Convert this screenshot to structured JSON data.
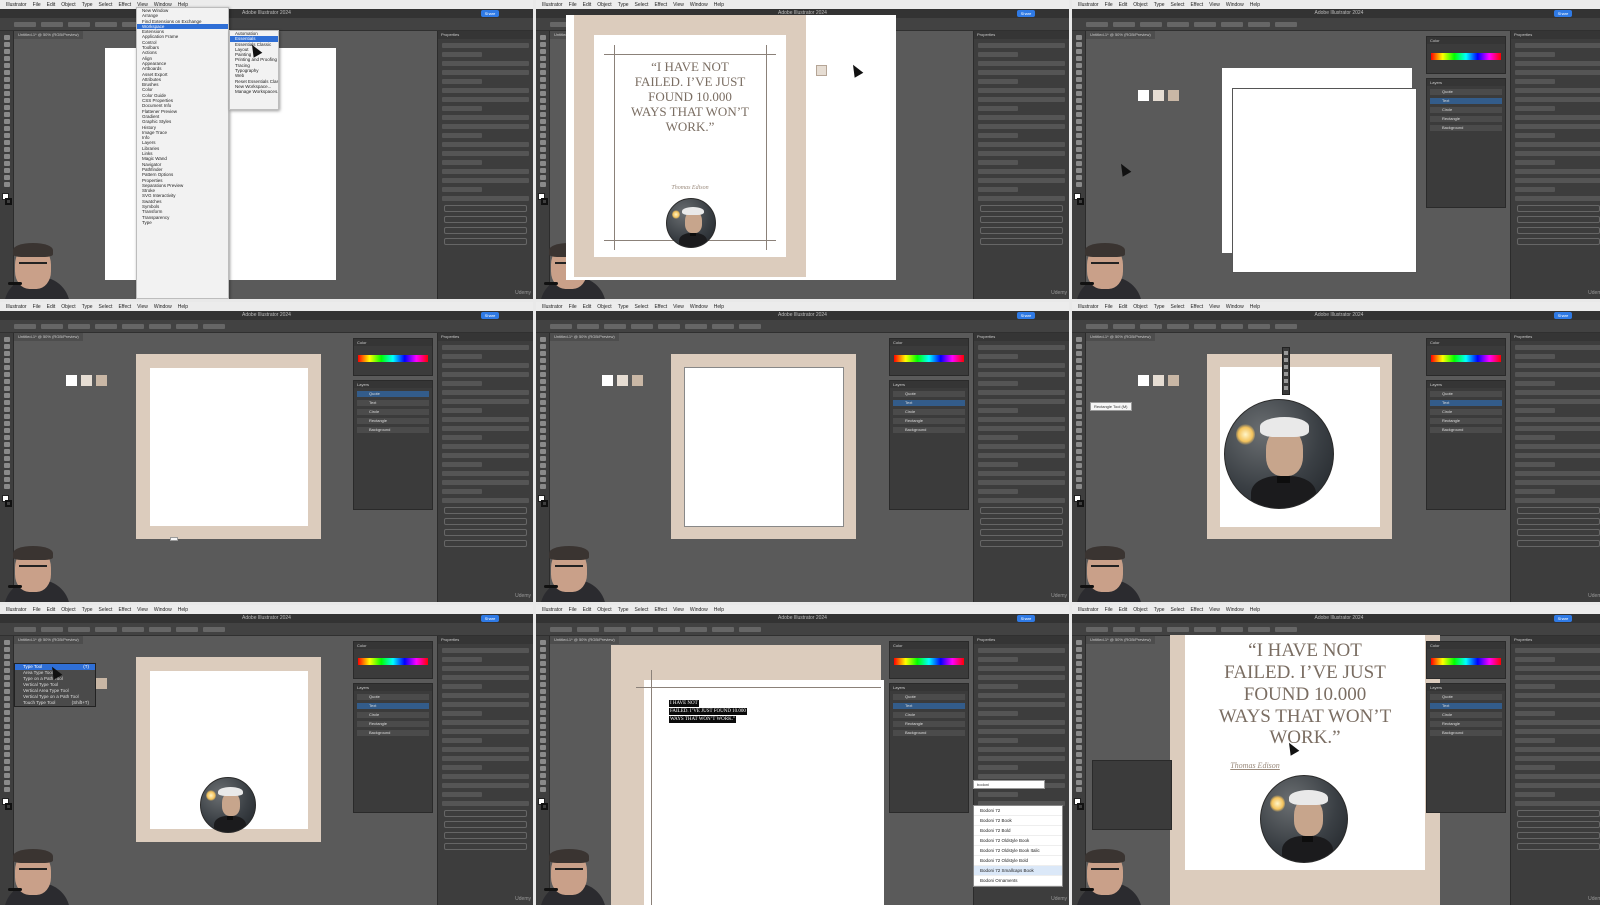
{
  "app": {
    "menubar": [
      "Illustrator",
      "File",
      "Edit",
      "Object",
      "Type",
      "Select",
      "Effect",
      "View",
      "Window",
      "Help"
    ],
    "title": "Adobe Illustrator 2024",
    "share": "Share",
    "doc_tab": "Untitled-1* @ 50% (RGB/Preview)",
    "watermark": "Udemy"
  },
  "colors": {
    "beige": "#dcccbd",
    "quote_text": "#7a6d62",
    "selection": "#2f6fd6",
    "canvas": "#5a5a5a"
  },
  "panels": {
    "properties": "Properties",
    "layers": "Layers",
    "color": "Color",
    "layer_items": [
      "Quote",
      "Text",
      "Circle",
      "Rectangle",
      "Background"
    ]
  },
  "window_menu": {
    "items": [
      "New Window",
      "Arrange",
      "Find Extensions on Exchange",
      "Workspace",
      "Extensions",
      "Application Frame",
      "Control",
      "Toolbars",
      "Actions",
      "Align",
      "Appearance",
      "Artboards",
      "Asset Export",
      "Attributes",
      "Brushes",
      "Color",
      "Color Guide",
      "CSS Properties",
      "Document Info",
      "Flattener Preview",
      "Gradient",
      "Graphic Styles",
      "History",
      "Image Trace",
      "Info",
      "Layers",
      "Libraries",
      "Links",
      "Magic Wand",
      "Navigator",
      "Pathfinder",
      "Pattern Options",
      "Properties",
      "Separations Preview",
      "Stroke",
      "SVG Interactivity",
      "Swatches",
      "Symbols",
      "Transform",
      "Transparency",
      "Type"
    ],
    "highlighted": "Workspace"
  },
  "workspace_menu": {
    "items": [
      "Automation",
      "Essentials",
      "Essentials Classic",
      "Layout",
      "Painting",
      "Printing and Proofing",
      "Tracing",
      "Typography",
      "Web",
      "Reset Essentials Classic",
      "New Workspace...",
      "Manage Workspaces..."
    ],
    "highlighted": "Essentials"
  },
  "quote": {
    "lines": [
      "“I HAVE NOT",
      "FAILED. I’VE JUST",
      "FOUND 10.000",
      "WAYS THAT WON’T",
      "WORK.”"
    ],
    "author": "Thomas Edison",
    "selected_lines": [
      "I HAVE NOT",
      "FAILED. I’VE JUST FOUND 10.000",
      "WAYS THAT WON’T WORK.”"
    ]
  },
  "type_tools": {
    "items": [
      "Type Tool",
      "Area Type Tool",
      "Type on a Path Tool",
      "Vertical Type Tool",
      "Vertical Area Type Tool",
      "Vertical Type on a Path Tool",
      "Touch Type Tool"
    ],
    "shortcuts": [
      "(T)",
      "",
      "",
      "",
      "",
      "",
      "(Shift+T)"
    ],
    "highlighted": "Type Tool"
  },
  "font_list": {
    "search": "bodoni",
    "items": [
      "Bodoni 72",
      "Bodoni 72 Book",
      "Bodoni 72 Bold",
      "Bodoni 72 Oldstyle Book",
      "Bodoni 72 Oldstyle Book Italic",
      "Bodoni 72 Oldstyle Bold",
      "Bodoni 72 Smallcaps Book",
      "Bodoni Ornaments"
    ],
    "highlighted": "Bodoni 72 Smallcaps Book"
  },
  "tooltip": "Rectangle Tool (M)"
}
